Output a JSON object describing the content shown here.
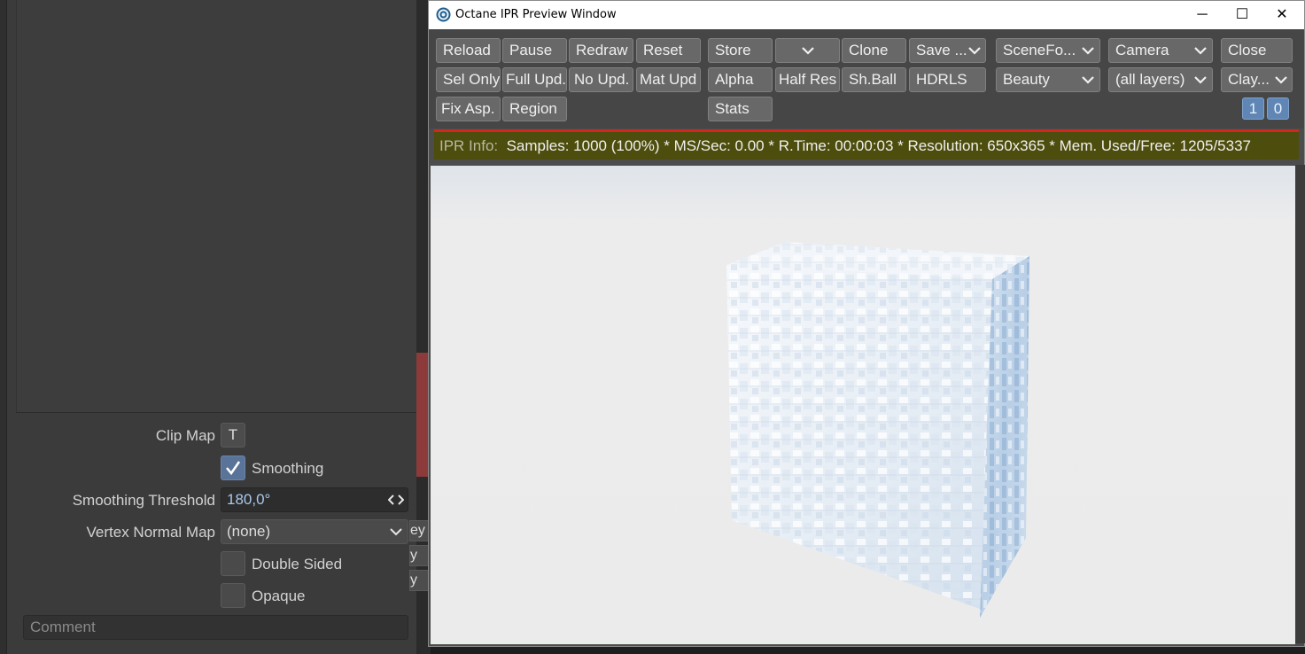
{
  "left_panel": {
    "clip_map": {
      "label": "Clip Map",
      "button": "T"
    },
    "smoothing": {
      "label": "Smoothing",
      "checked": true
    },
    "smoothing_threshold": {
      "label": "Smoothing Threshold",
      "value": "180,0°"
    },
    "vertex_normal_map": {
      "label": "Vertex Normal Map",
      "value": "(none)"
    },
    "double_sided": {
      "label": "Double Sided",
      "checked": false
    },
    "opaque": {
      "label": "Opaque",
      "checked": false
    },
    "comment": {
      "placeholder": "Comment"
    }
  },
  "background_fragments": [
    "ey",
    "y",
    "y"
  ],
  "window": {
    "title": "Octane IPR Preview Window",
    "controls": {
      "minimize": "─",
      "maximize": "☐",
      "close": "✕"
    }
  },
  "toolbar": {
    "row1": {
      "reload": "Reload",
      "pause": "Pause",
      "redraw": "Redraw",
      "reset": "Reset",
      "store": "Store",
      "store_dropdown": "",
      "clone": "Clone",
      "save": "Save ...",
      "scene_format": "SceneFo...",
      "camera": "Camera",
      "close": "Close"
    },
    "row2": {
      "sel_only": "Sel Only",
      "full_upd": "Full Upd.",
      "no_upd": "No Upd.",
      "mat_upd": "Mat Upd",
      "alpha": "Alpha",
      "half_res": "Half Res",
      "sh_ball": "Sh.Ball",
      "hdrls": "HDRLS",
      "beauty": "Beauty",
      "all_layers": "(all layers)",
      "clay": "Clay..."
    },
    "row3": {
      "fix_asp": "Fix Asp.",
      "region": "Region",
      "stats": "Stats",
      "counter_1": "1",
      "counter_0": "0"
    }
  },
  "ipr_info": {
    "label": "IPR Info:",
    "text": "Samples: 1000 (100%)  *  MS/Sec: 0.00  *  R.Time: 00:00:03  *  Resolution: 650x365  *  Mem. Used/Free: 1205/5337"
  },
  "colors": {
    "accent_blue": "#5f86b5",
    "status_red": "#d4261f",
    "info_bg": "#4d4d0d"
  }
}
